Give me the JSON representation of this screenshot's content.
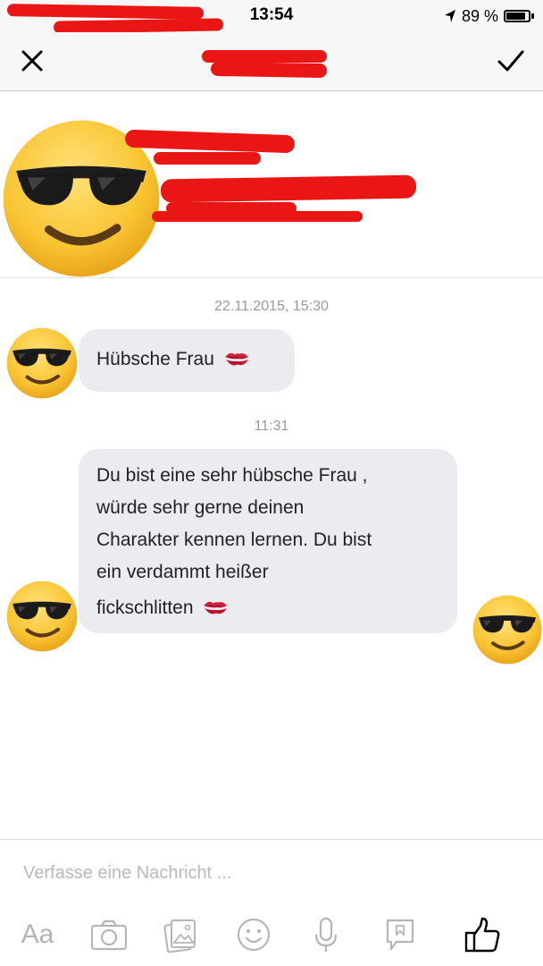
{
  "status_bar": {
    "time": "13:54",
    "battery_text": "89 %",
    "battery_level": 0.89,
    "icons": [
      "location-arrow-icon",
      "battery-icon"
    ]
  },
  "nav_bar": {
    "close_icon": "close-icon",
    "confirm_icon": "checkmark-icon"
  },
  "colors": {
    "redaction": "#ea1616",
    "bubble_bg": "#ececf0",
    "timestamp": "#9a9a9a",
    "toolbar_icon": "#b5b5b5"
  },
  "profile": {
    "avatar_icon": "sunglasses-emoji-icon"
  },
  "conversation": {
    "groups": [
      {
        "timestamp": "22.11.2015, 15:30",
        "messages": [
          {
            "text": "Hübsche Frau",
            "emoji_icon": "kiss-mark-icon"
          }
        ]
      },
      {
        "timestamp": "11:31",
        "messages": [
          {
            "lines": [
              "Du bist eine sehr hübsche Frau ,",
              "würde sehr gerne deinen",
              "Charakter kennen lernen. Du bist",
              "ein verdammt heißer",
              "fickschlitten"
            ],
            "emoji_icon": "kiss-mark-icon"
          }
        ]
      }
    ],
    "seen_indicator_icon": "sunglasses-emoji-icon"
  },
  "composer": {
    "placeholder": "Verfasse eine Nachricht ...",
    "toolbar": {
      "text_format_label": "Aa",
      "icons": [
        "camera-icon",
        "gallery-icon",
        "emoji-icon",
        "microphone-icon",
        "sticker-icon",
        "thumbs-up-icon"
      ]
    }
  }
}
